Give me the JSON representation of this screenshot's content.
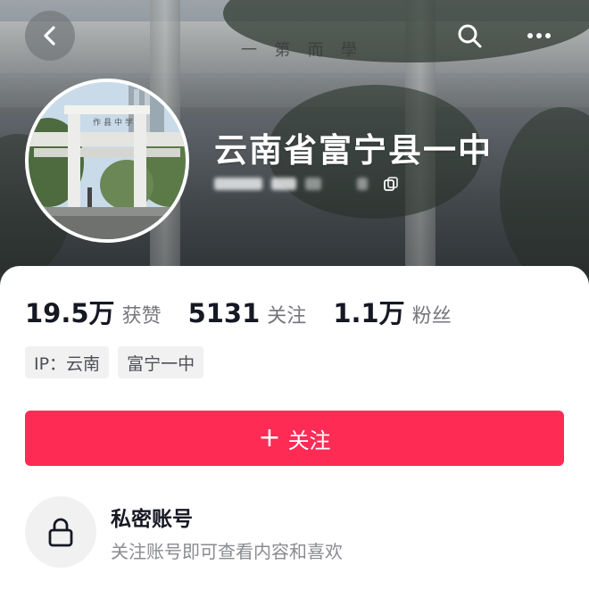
{
  "header": {
    "back_icon": "chevron-left-icon",
    "search_icon": "search-icon",
    "more_icon": "more-horizontal-icon"
  },
  "cover": {
    "engraving_chars": [
      "一",
      "第",
      "而",
      "學"
    ]
  },
  "profile": {
    "name": "云南省富宁县一中",
    "avatar_sign_chars": [
      "作",
      "县",
      "中",
      "学"
    ]
  },
  "stats": [
    {
      "value": "19.5万",
      "label": "获赞"
    },
    {
      "value": "5131",
      "label": "关注"
    },
    {
      "value": "1.1万",
      "label": "粉丝"
    }
  ],
  "tags": [
    {
      "text": "IP：云南"
    },
    {
      "text": "富宁一中"
    }
  ],
  "follow_button": {
    "plus": "+",
    "label": "关注"
  },
  "private_account": {
    "title": "私密账号",
    "description": "关注账号即可查看内容和喜欢",
    "icon": "lock-icon"
  },
  "colors": {
    "accent": "#fe2c55",
    "text_primary": "#161823",
    "text_secondary": "#75767c",
    "tag_bg": "#f1f1f2"
  }
}
